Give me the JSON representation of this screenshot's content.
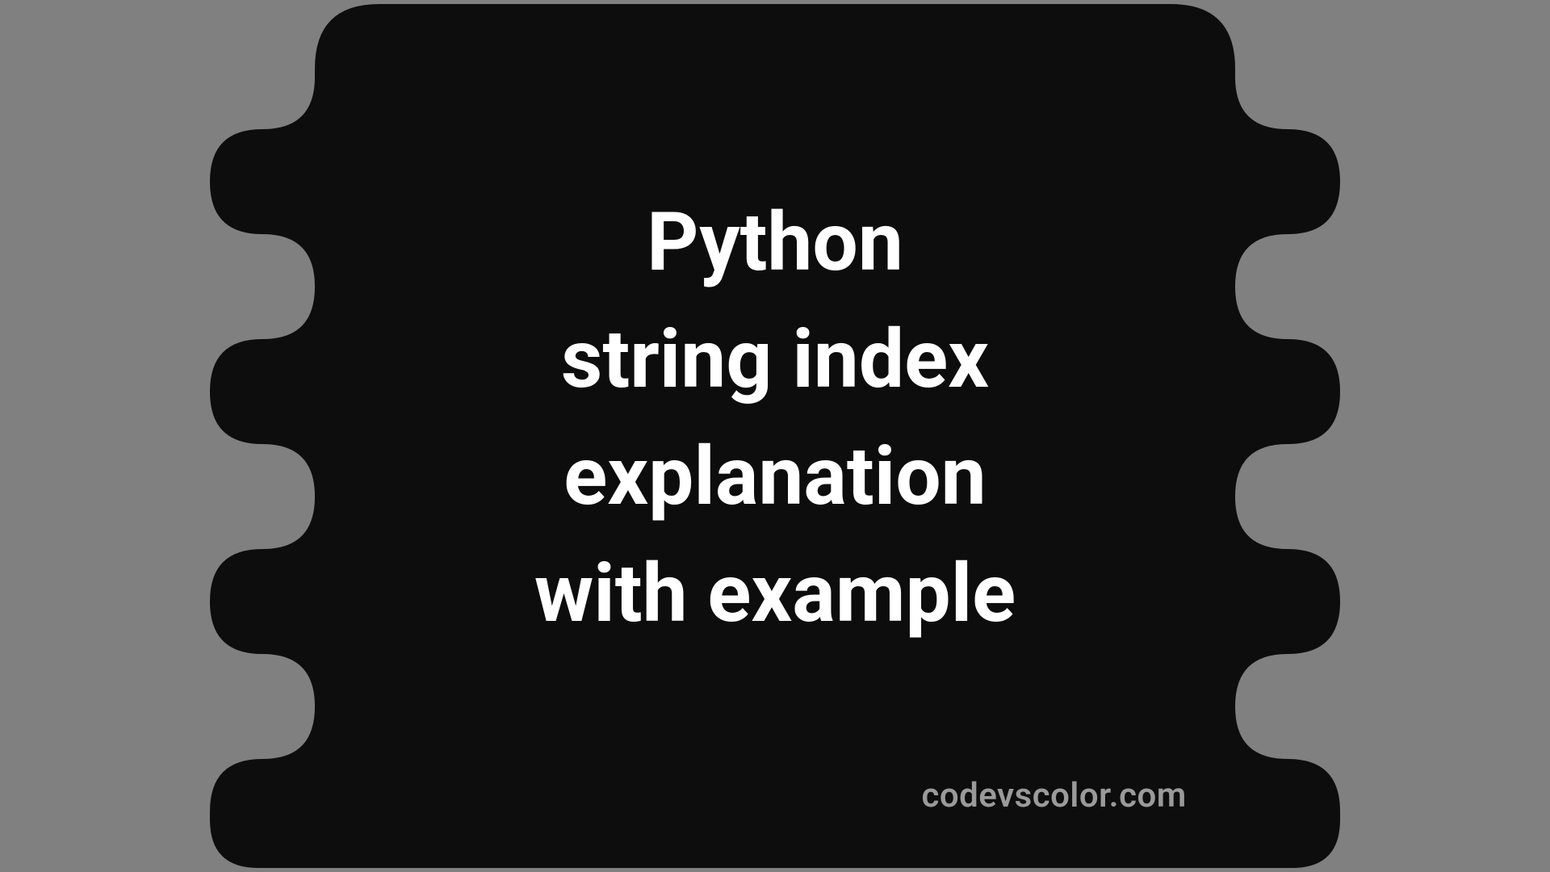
{
  "title": {
    "line1": "Python",
    "line2": "string index",
    "line3": "explanation",
    "line4": "with example"
  },
  "watermark": "codevscolor.com",
  "colors": {
    "background": "#808080",
    "blob": "#0d0d0d",
    "text": "#ffffff",
    "watermark": "#9a9a9a"
  }
}
